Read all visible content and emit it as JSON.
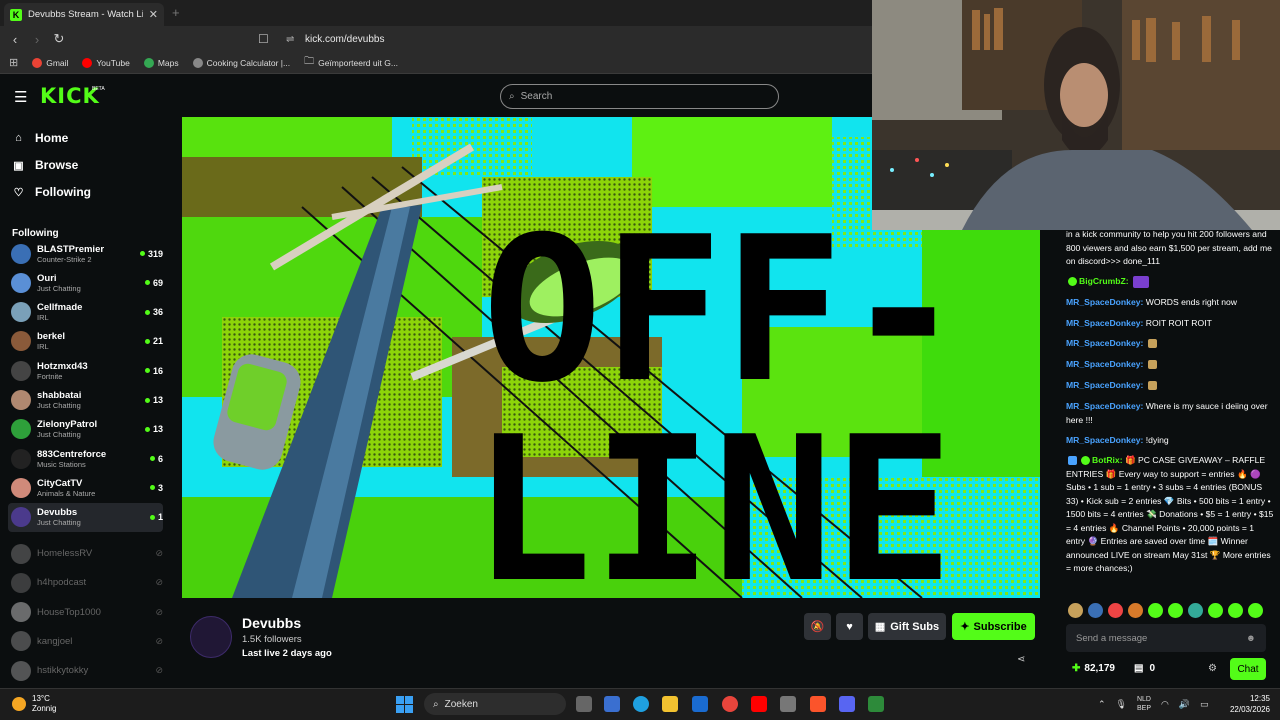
{
  "browser": {
    "tab_title": "Devubbs Stream - Watch Live on Kick",
    "tab_close": "✕",
    "new_tab": "+",
    "url": "kick.com/devubbs",
    "bookmarks": [
      {
        "label": "Gmail",
        "color": "#ea4335"
      },
      {
        "label": "YouTube",
        "color": "#ff0000"
      },
      {
        "label": "Maps",
        "color": "#34a853"
      },
      {
        "label": "Cooking Calculator |...",
        "color": "#888888"
      },
      {
        "label": "Geïmporteerd uit G...",
        "color": "#cccccc"
      }
    ]
  },
  "kick": {
    "logo": "KICK",
    "beta": "BETA",
    "search_placeholder": "Search",
    "nav": {
      "home": "Home",
      "browse": "Browse",
      "following": "Following"
    },
    "following_heading": "Following"
  },
  "channels": [
    {
      "name": "BLASTPremier",
      "category": "Counter-Strike 2",
      "viewers": "319",
      "color": "#3a6fb5"
    },
    {
      "name": "Ouri",
      "category": "Just Chatting",
      "viewers": "69",
      "color": "#5a8fd6"
    },
    {
      "name": "Cellfmade",
      "category": "IRL",
      "viewers": "36",
      "color": "#7aa0b8"
    },
    {
      "name": "berkel",
      "category": "IRL",
      "viewers": "21",
      "color": "#8a5a3a"
    },
    {
      "name": "Hotzmxd43",
      "category": "Fortnite",
      "viewers": "16",
      "color": "#444444"
    },
    {
      "name": "shabbatai",
      "category": "Just Chatting",
      "viewers": "13",
      "color": "#b08870"
    },
    {
      "name": "ZielonyPatrol",
      "category": "Just Chatting",
      "viewers": "13",
      "color": "#2ea03a"
    },
    {
      "name": "883Centreforce",
      "category": "Music Stations",
      "viewers": "6",
      "color": "#222222"
    },
    {
      "name": "CityCatTV",
      "category": "Animals & Nature",
      "viewers": "3",
      "color": "#d08a7a"
    },
    {
      "name": "Devubbs",
      "category": "Just Chatting",
      "viewers": "1",
      "color": "#4b3a8c"
    }
  ],
  "offline_channels": [
    {
      "name": "HomelessRV",
      "color": "#888888"
    },
    {
      "name": "h4hpodcast",
      "color": "#777777"
    },
    {
      "name": "HouseTop1000",
      "color": "#dddddd"
    },
    {
      "name": "kangjoel",
      "color": "#999999"
    },
    {
      "name": "hstikkytokky",
      "color": "#aaaaaa"
    }
  ],
  "channel": {
    "name": "Devubbs",
    "followers": "1.5K followers",
    "last_live": "Last live 2 days ago",
    "gift_label": "Gift Subs",
    "subscribe_label": "Subscribe",
    "banner_text_1": "OFF-",
    "banner_text_2": "LINE"
  },
  "chat": {
    "messages": [
      {
        "user": "",
        "text": "in a kick community to help you hit 200 followers and 800 viewers and also earn $1,500 per stream, add me on discord>>> done_111"
      },
      {
        "user": "BigCrumbZ",
        "text": "",
        "green": true
      },
      {
        "user": "MR_SpaceDonkey",
        "text": "WORDS ends right now"
      },
      {
        "user": "MR_SpaceDonkey",
        "text": "ROIT ROIT ROIT"
      },
      {
        "user": "MR_SpaceDonkey",
        "text": ""
      },
      {
        "user": "MR_SpaceDonkey",
        "text": ""
      },
      {
        "user": "MR_SpaceDonkey",
        "text": ""
      },
      {
        "user": "MR_SpaceDonkey",
        "text": "Where is my sauce i deiing over here !!!"
      },
      {
        "user": "MR_SpaceDonkey",
        "text": "!dying"
      },
      {
        "user": "BotRix",
        "text": "🎁 PC CASE GIVEAWAY – RAFFLE ENTRIES 🎁 Every way to support = entries 🔥 🟣 Subs • 1 sub = 1 entry • 3 subs = 4 entries (BONUS 33) • Kick sub = 2 entries 💎 Bits • 500 bits = 1 entry • 1500 bits = 4 entries 💸 Donations • $5 = 1 entry • $15 = 4 entries 🔥 Channel Points • 20,000 points = 1 entry 🔮 Entries are saved over time 🗓️ Winner announced LIVE on stream May 31st 🏆 More entries = more chances;)",
        "green": true
      }
    ],
    "input_placeholder": "Send a message",
    "points": "82,179",
    "count": "0",
    "chat_button": "Chat"
  },
  "taskbar": {
    "temp": "13°C",
    "weather": "Zonnig",
    "search": "Zoeken",
    "lang1": "NLD",
    "lang2": "BEP",
    "time": "12:35",
    "date": "22/03/2026"
  }
}
